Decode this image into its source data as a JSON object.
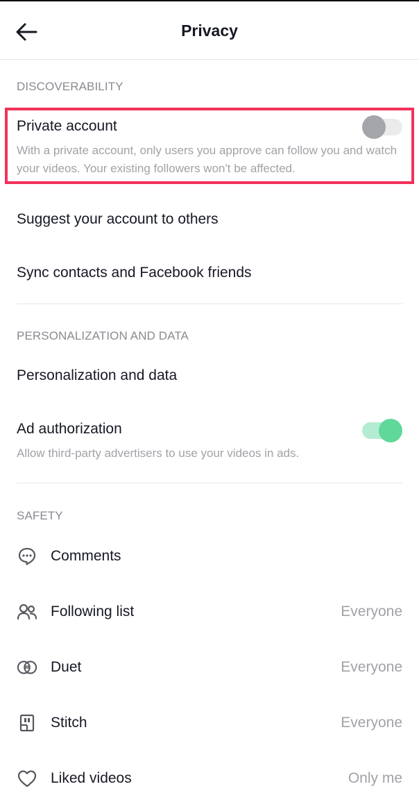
{
  "header": {
    "title": "Privacy"
  },
  "discoverability": {
    "section_title": "DISCOVERABILITY",
    "private_account": {
      "label": "Private account",
      "description": "With a private account, only users you approve can follow you and watch your videos. Your existing followers won't be affected.",
      "enabled": false
    },
    "suggest_account": {
      "label": "Suggest your account to others"
    },
    "sync_contacts": {
      "label": "Sync contacts and Facebook friends"
    }
  },
  "personalization": {
    "section_title": "PERSONALIZATION AND DATA",
    "personalization_data": {
      "label": "Personalization and data"
    },
    "ad_authorization": {
      "label": "Ad authorization",
      "description": "Allow third-party advertisers to use your videos in ads.",
      "enabled": true
    }
  },
  "safety": {
    "section_title": "SAFETY",
    "items": [
      {
        "label": "Comments",
        "value": "",
        "icon": "comment-icon"
      },
      {
        "label": "Following list",
        "value": "Everyone",
        "icon": "people-icon"
      },
      {
        "label": "Duet",
        "value": "Everyone",
        "icon": "duet-icon"
      },
      {
        "label": "Stitch",
        "value": "Everyone",
        "icon": "stitch-icon"
      },
      {
        "label": "Liked videos",
        "value": "Only me",
        "icon": "heart-icon"
      }
    ]
  },
  "colors": {
    "highlight": "#f2315a",
    "toggle_on": "#5fd89a",
    "toggle_off": "#a5a6aa"
  }
}
